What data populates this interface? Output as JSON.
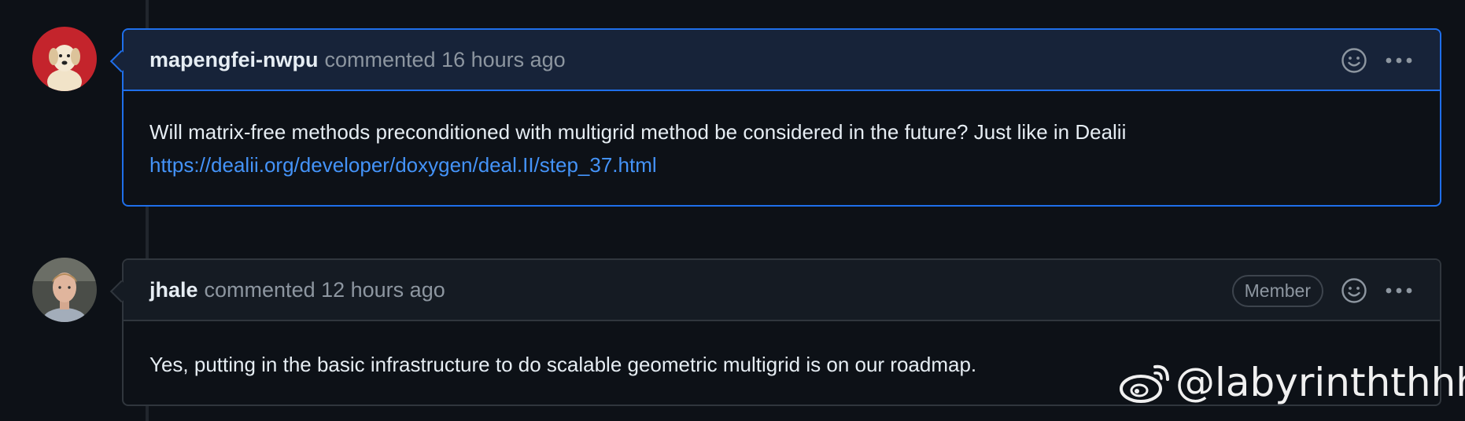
{
  "comments": [
    {
      "author": "mapengfei-nwpu",
      "meta": "commented 16 hours ago",
      "badge": "",
      "body_text": "Will matrix-free methods preconditioned with multigrid method be considered in the future? Just like in Dealii",
      "body_link": "https://dealii.org/developer/doxygen/deal.II/step_37.html",
      "avatar_icon": "dog-avatar"
    },
    {
      "author": "jhale",
      "meta": "commented 12 hours ago",
      "badge": "Member",
      "body_text": "Yes, putting in the basic infrastructure to do scalable geometric multigrid is on our roadmap.",
      "avatar_icon": "person-avatar"
    }
  ],
  "watermark": {
    "handle": "@labyrinththhh",
    "icon": "weibo-icon"
  },
  "colors": {
    "background": "#0d1117",
    "highlight_border": "#1f6feb",
    "highlight_header": "#172339",
    "link": "#4493f8"
  }
}
